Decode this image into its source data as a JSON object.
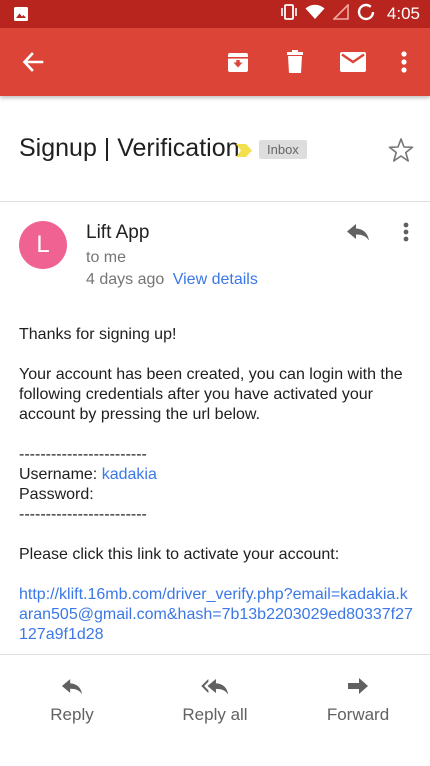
{
  "status_bar": {
    "time": "4:05",
    "icons": [
      "image-icon",
      "vibrate-icon",
      "wifi-icon",
      "signal-icon",
      "battery-ring-icon"
    ]
  },
  "app_bar": {
    "icons": [
      "back-arrow-icon",
      "archive-icon",
      "delete-icon",
      "mark-unread-icon",
      "more-vert-icon"
    ]
  },
  "email": {
    "subject": "Signup | Verification",
    "label": "Inbox",
    "sender": {
      "initial": "L",
      "name": "Lift App",
      "to": "to me",
      "date": "4 days ago",
      "details_link": "View details"
    },
    "body": {
      "greeting": "Thanks for signing up!",
      "paragraph": "Your account has been created, you can login with the following credentials after you have activated your account by pressing the url below.",
      "divider_top": "------------------------",
      "username_label": "Username:",
      "username_value": "kadakia",
      "password_label": "Password:",
      "divider_bottom": "------------------------",
      "activate_prompt": "Please click this link to activate your account:",
      "activation_url": "http://klift.16mb.com/driver_verify.php?email=kadakia.karan505@gmail.com&hash=7b13b2203029ed80337f27127a9f1d28"
    }
  },
  "actions": {
    "reply": "Reply",
    "reply_all": "Reply all",
    "forward": "Forward"
  },
  "colors": {
    "status_bar": "#b8251e",
    "app_bar": "#db4437",
    "avatar": "#f06292",
    "link": "#3b78e7",
    "importance": "#f4e04d"
  }
}
